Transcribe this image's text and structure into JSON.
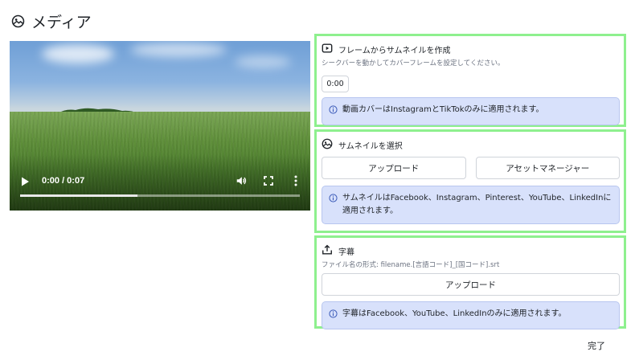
{
  "page": {
    "title": "メディア",
    "title_icon": "image-icon"
  },
  "video": {
    "time_display": "0:00 / 0:07",
    "progress": 0.42,
    "controls": [
      "play-icon",
      "volume-icon",
      "fullscreen-icon",
      "more-icon"
    ]
  },
  "frame_panel": {
    "title": "フレームからサムネイルを作成",
    "icon": "play-icon",
    "subtitle": "シークバーを動かしてカバーフレームを設定してください。",
    "time_value": "0:00",
    "info": "動画カバーはInstagramとTikTokのみに適用されます。"
  },
  "thumbnail_panel": {
    "title": "サムネイルを選択",
    "icon": "image-icon",
    "upload_label": "アップロード",
    "asset_manager_label": "アセットマネージャー",
    "info": "サムネイルはFacebook、Instagram、Pinterest、YouTube、LinkedInに適用されます。"
  },
  "subtitle_panel": {
    "title": "字幕",
    "icon": "upload-icon",
    "subtitle": "ファイル名の形式: filename.[言語コード]_[国コード].srt",
    "upload_label": "アップロード",
    "info": "字幕はFacebook、YouTube、LinkedInのみに適用されます。"
  },
  "footer": {
    "done_label": "完了"
  },
  "colors": {
    "panel_border": "#8ef08e",
    "info_bg": "#d8e1fb",
    "info_icon": "#3b5bb8"
  }
}
